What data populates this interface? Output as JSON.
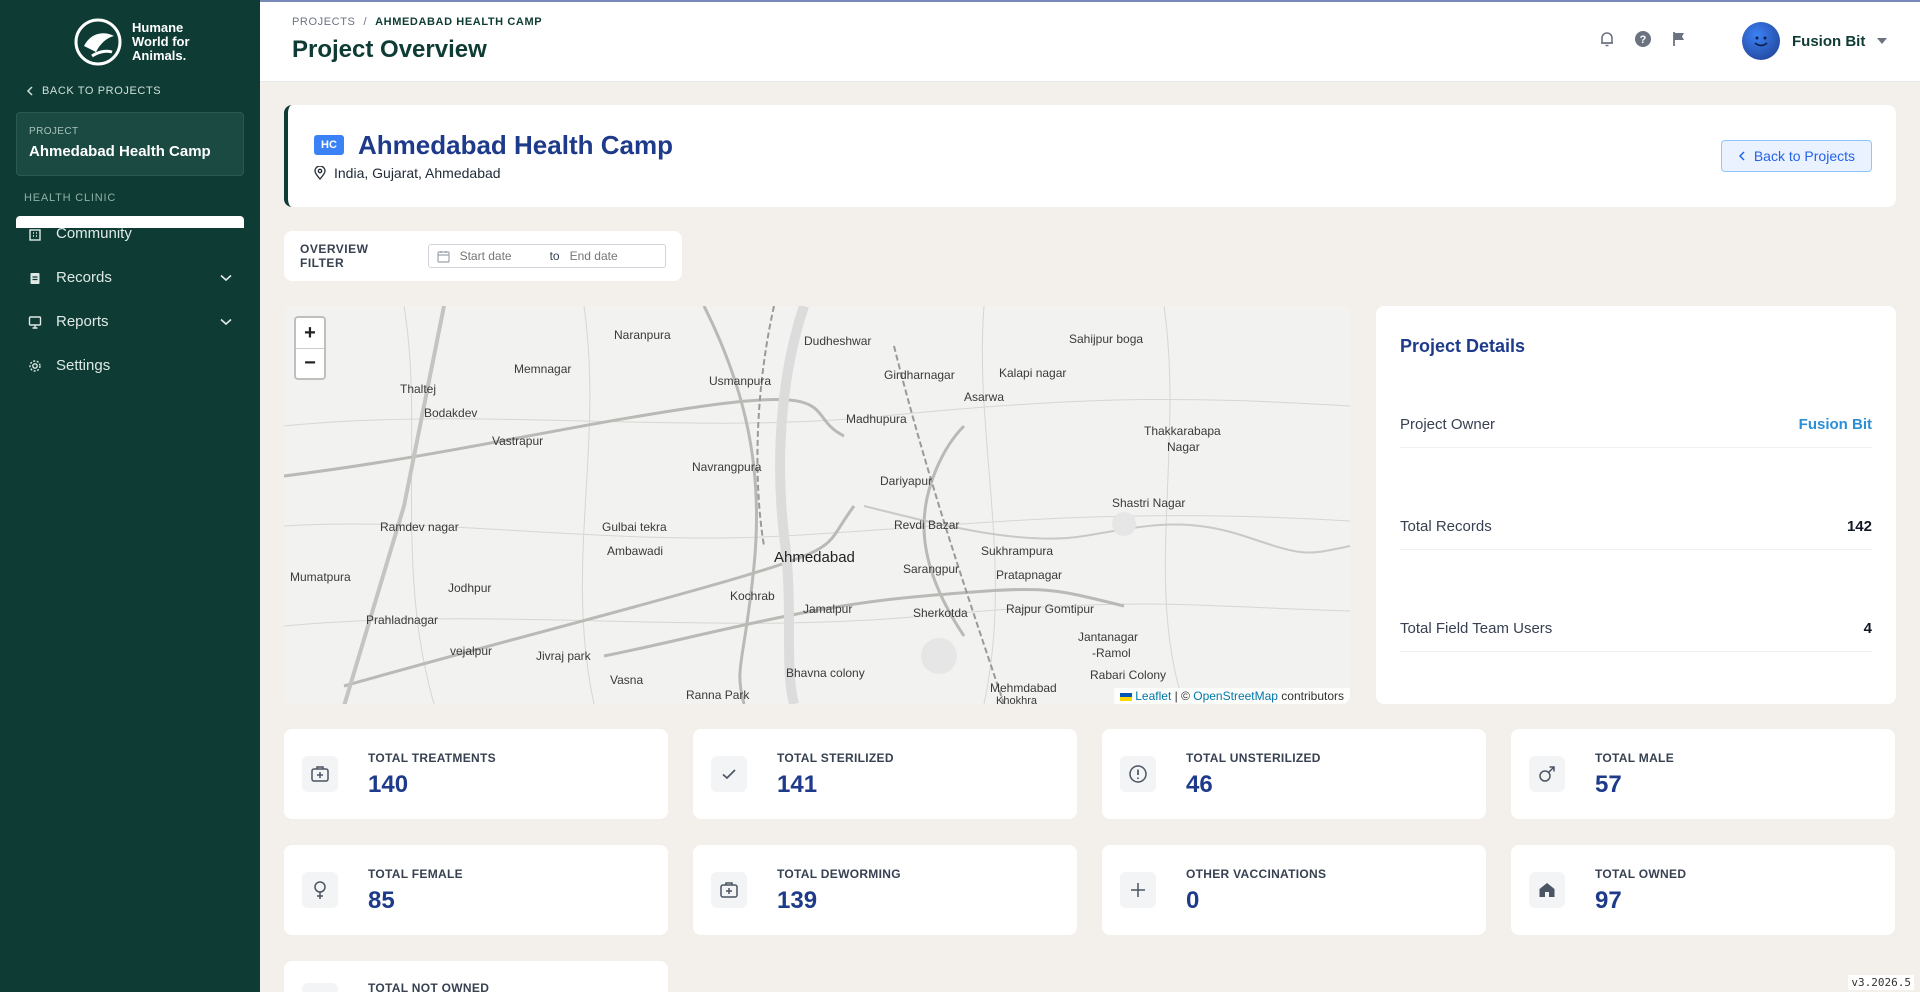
{
  "sidebar": {
    "logo_lines": [
      "Humane",
      "World for",
      "Animals."
    ],
    "back_label": "BACK TO PROJECTS",
    "project_label": "PROJECT",
    "project_name": "Ahmedabad Health Camp",
    "section_label": "HEALTH CLINIC",
    "nav": [
      {
        "label": "Community"
      },
      {
        "label": "Records"
      },
      {
        "label": "Reports"
      },
      {
        "label": "Settings"
      }
    ]
  },
  "header": {
    "breadcrumb_root": "PROJECTS",
    "breadcrumb_sep": "/",
    "breadcrumb_current": "AHMEDABAD HEALTH CAMP",
    "title": "Project Overview",
    "user_name": "Fusion Bit"
  },
  "project": {
    "badge": "HC",
    "title": "Ahmedabad Health Camp",
    "location": "India, Gujarat, Ahmedabad",
    "back_button": "Back to Projects"
  },
  "filter": {
    "label": "OVERVIEW FILTER",
    "start_placeholder": "Start date",
    "to": "to",
    "end_placeholder": "End date"
  },
  "map": {
    "zoom_in": "+",
    "zoom_out": "−",
    "attribution_leaflet": "Leaflet",
    "attribution_sep": " | © ",
    "attribution_osm": "OpenStreetMap",
    "attribution_tail": " contributors",
    "places": [
      {
        "name": "Naranpura"
      },
      {
        "name": "Dudheshwar"
      },
      {
        "name": "Sahijpur boga"
      },
      {
        "name": "Memnagar"
      },
      {
        "name": "Girdharnagar"
      },
      {
        "name": "Kalapi nagar"
      },
      {
        "name": "Thaltej"
      },
      {
        "name": "Usmanpura"
      },
      {
        "name": "Asarwa"
      },
      {
        "name": "Bodakdev"
      },
      {
        "name": "Madhupura"
      },
      {
        "name": "Thakkarabapa"
      },
      {
        "name": "Vastrapur"
      },
      {
        "name": "Nagar"
      },
      {
        "name": "Navrangpura"
      },
      {
        "name": "Dariyapur"
      },
      {
        "name": "Shastri Nagar"
      },
      {
        "name": "Ramdev nagar"
      },
      {
        "name": "Gulbai tekra"
      },
      {
        "name": "Revdi Bazar"
      },
      {
        "name": "Ambawadi"
      },
      {
        "name": "Ahmedabad"
      },
      {
        "name": "Sukhrampura"
      },
      {
        "name": "Mumatpura"
      },
      {
        "name": "Sarangpur"
      },
      {
        "name": "Pratapnagar"
      },
      {
        "name": "Jodhpur"
      },
      {
        "name": "Kochrab"
      },
      {
        "name": "Prahladnagar"
      },
      {
        "name": "Jamalpur"
      },
      {
        "name": "Sherkotda"
      },
      {
        "name": "Rajpur Gomtipur"
      },
      {
        "name": "vejalpur"
      },
      {
        "name": "Jivraj park"
      },
      {
        "name": "Jantanagar"
      },
      {
        "name": "-Ramol"
      },
      {
        "name": "Vasna"
      },
      {
        "name": "Bhavna colony"
      },
      {
        "name": "Rabari Colony"
      },
      {
        "name": "Ranna Park"
      },
      {
        "name": "Mehmdabad"
      },
      {
        "name": "Khokhra"
      }
    ]
  },
  "details": {
    "title": "Project Details",
    "rows": [
      {
        "label": "Project Owner",
        "value": "Fusion Bit"
      },
      {
        "label": "Total Records",
        "value": "142"
      },
      {
        "label": "Total Field Team Users",
        "value": "4"
      }
    ]
  },
  "stats": [
    {
      "label": "TOTAL TREATMENTS",
      "value": "140",
      "icon": "medical-kit-icon"
    },
    {
      "label": "TOTAL STERILIZED",
      "value": "141",
      "icon": "check-icon"
    },
    {
      "label": "TOTAL UNSTERILIZED",
      "value": "46",
      "icon": "alert-circle-icon"
    },
    {
      "label": "TOTAL MALE",
      "value": "57",
      "icon": "male-icon"
    },
    {
      "label": "TOTAL FEMALE",
      "value": "85",
      "icon": "female-icon"
    },
    {
      "label": "TOTAL DEWORMING",
      "value": "139",
      "icon": "medical-kit-icon"
    },
    {
      "label": "OTHER VACCINATIONS",
      "value": "0",
      "icon": "plus-icon"
    },
    {
      "label": "TOTAL OWNED",
      "value": "97",
      "icon": "home-icon"
    },
    {
      "label": "TOTAL NOT OWNED",
      "value": "",
      "icon": "home-outline-icon"
    }
  ],
  "version": "v3.2026.5"
}
